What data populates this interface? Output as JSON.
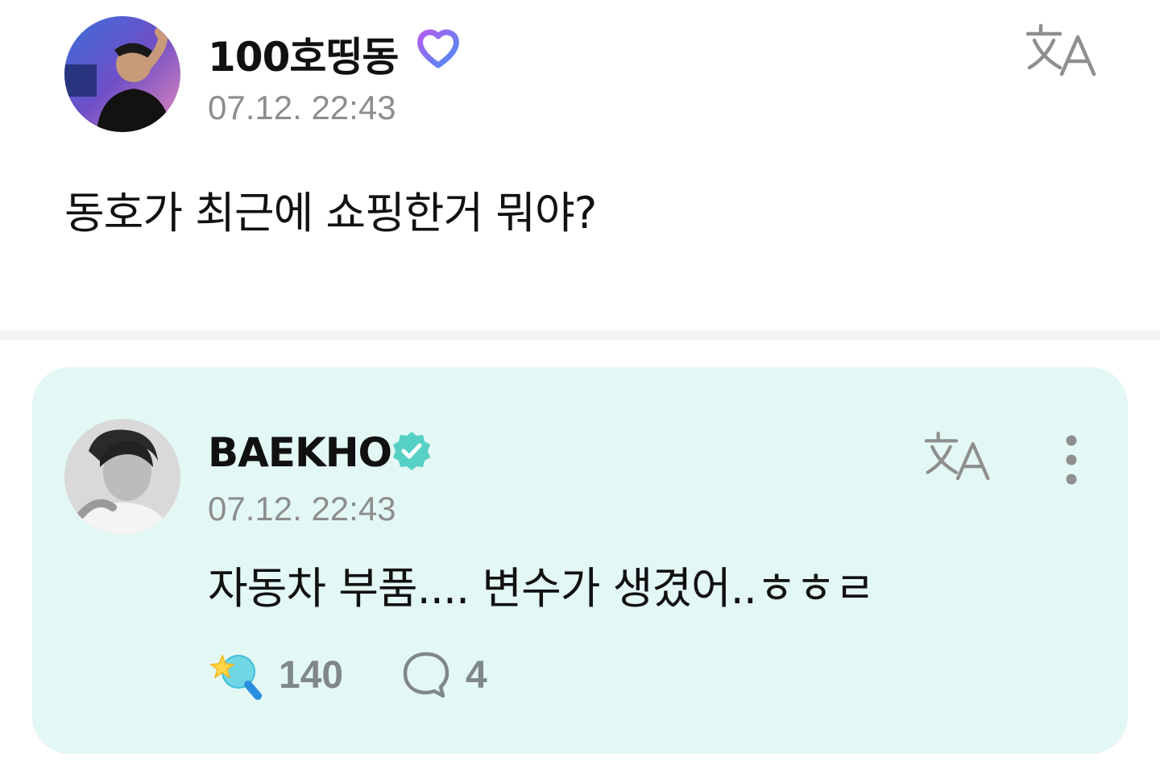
{
  "post": {
    "author": "100호띵동",
    "author_badge_icon": "membership-heart-icon",
    "timestamp": "07.12. 22:43",
    "text": "동호가 최근에 쇼핑한거 뭐야?",
    "translate_icon": "translate-icon"
  },
  "reply": {
    "author": "BAEKHO",
    "author_badge_icon": "verified-check-icon",
    "timestamp": "07.12. 22:43",
    "text": "자동차 부품.... 변수가 생겼어..ㅎㅎㄹ",
    "translate_icon": "translate-icon",
    "more_icon": "more-vertical-icon",
    "likes": "140",
    "comments": "4",
    "background_color": "#e3f8f5"
  },
  "colors": {
    "text": "#111111",
    "muted": "#8d8d8d",
    "verified": "#56d0c4",
    "membership": "#7b6cf0"
  }
}
